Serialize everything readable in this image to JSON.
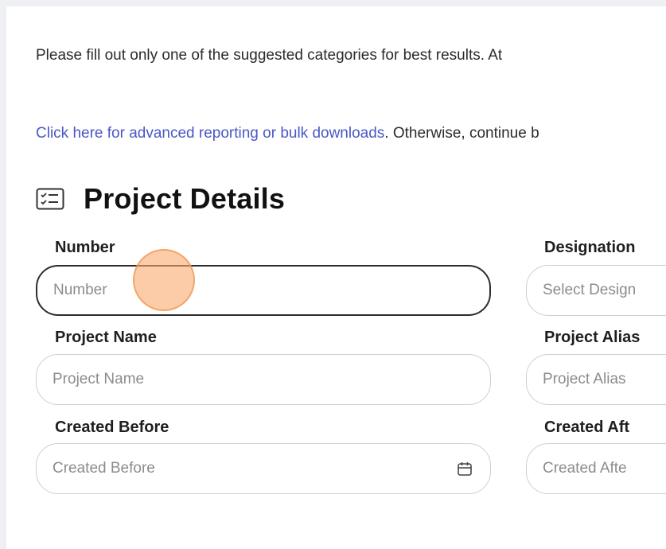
{
  "intro": {
    "text": "Please fill out only one of the suggested categories for best results. At"
  },
  "link_line": {
    "link_text": "Click here for advanced reporting or bulk downloads",
    "rest_text": ". Otherwise, continue b"
  },
  "section": {
    "title": "Project Details",
    "icon": "checklist-icon"
  },
  "fields": {
    "number": {
      "label": "Number",
      "placeholder": "Number"
    },
    "designation": {
      "label": "Designation",
      "placeholder": "Select Design"
    },
    "project_name": {
      "label": "Project Name",
      "placeholder": "Project Name"
    },
    "project_alias": {
      "label": "Project Alias",
      "placeholder": "Project Alias"
    },
    "created_before": {
      "label": "Created Before",
      "placeholder": "Created Before",
      "icon": "calendar-icon"
    },
    "created_after": {
      "label": "Created Aft",
      "placeholder": "Created Afte"
    }
  },
  "colors": {
    "link": "#4a57c6",
    "focus_border": "#2d2d2d",
    "cursor_highlight": "#f7a96a"
  }
}
